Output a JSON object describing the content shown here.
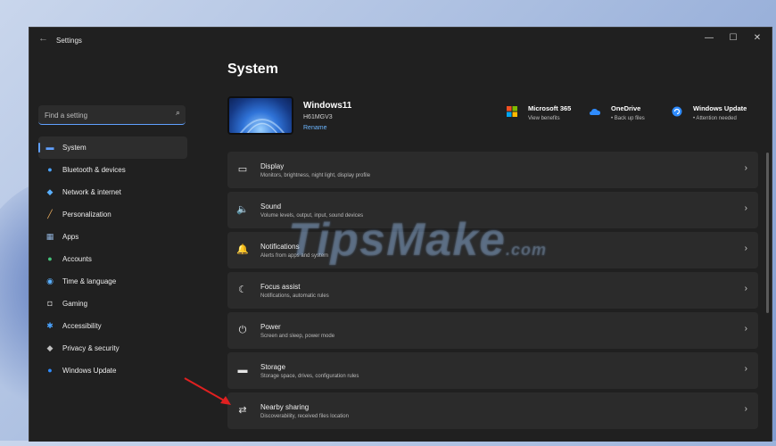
{
  "window": {
    "app_title": "Settings",
    "back_icon": "←",
    "controls": {
      "minimize": "—",
      "maximize": "☐",
      "close": "✕"
    }
  },
  "page": {
    "title": "System"
  },
  "search": {
    "placeholder": "Find a setting",
    "icon": "search-icon"
  },
  "sidebar": {
    "items": [
      {
        "label": "System",
        "icon": "monitor-icon",
        "active": true,
        "color": "#60a0ff"
      },
      {
        "label": "Bluetooth & devices",
        "icon": "bluetooth-icon",
        "color": "#4aa3ff"
      },
      {
        "label": "Network & internet",
        "icon": "wifi-icon",
        "color": "#5ab0ff"
      },
      {
        "label": "Personalization",
        "icon": "brush-icon",
        "color": "#f0b060"
      },
      {
        "label": "Apps",
        "icon": "apps-icon",
        "color": "#8fb0d8"
      },
      {
        "label": "Accounts",
        "icon": "person-icon",
        "color": "#45c27a"
      },
      {
        "label": "Time & language",
        "icon": "globe-icon",
        "color": "#5ab0ff"
      },
      {
        "label": "Gaming",
        "icon": "gamepad-icon",
        "color": "#b0b0b0"
      },
      {
        "label": "Accessibility",
        "icon": "accessibility-icon",
        "color": "#4aa3ff"
      },
      {
        "label": "Privacy & security",
        "icon": "shield-icon",
        "color": "#c0c0c0"
      },
      {
        "label": "Windows Update",
        "icon": "update-icon",
        "color": "#2f8cff"
      }
    ]
  },
  "device": {
    "name": "Windows11",
    "model": "H61MGV3",
    "rename_label": "Rename"
  },
  "quick_links": [
    {
      "title": "Microsoft 365",
      "subtitle": "View benefits",
      "icon": "microsoft-logo-icon"
    },
    {
      "title": "OneDrive",
      "subtitle": "• Back up files",
      "icon": "cloud-icon"
    },
    {
      "title": "Windows Update",
      "subtitle": "• Attention needed",
      "icon": "update-icon"
    }
  ],
  "settings": [
    {
      "title": "Display",
      "description": "Monitors, brightness, night light, display profile",
      "icon": "display-icon",
      "glyph": "▭"
    },
    {
      "title": "Sound",
      "description": "Volume levels, output, input, sound devices",
      "icon": "speaker-icon",
      "glyph": "🔈"
    },
    {
      "title": "Notifications",
      "description": "Alerts from apps and system",
      "icon": "bell-icon",
      "glyph": "🔔"
    },
    {
      "title": "Focus assist",
      "description": "Notifications, automatic rules",
      "icon": "moon-icon",
      "glyph": "☾"
    },
    {
      "title": "Power",
      "description": "Screen and sleep, power mode",
      "icon": "power-icon",
      "glyph": "⏻"
    },
    {
      "title": "Storage",
      "description": "Storage space, drives, configuration rules",
      "icon": "storage-icon",
      "glyph": "▬"
    },
    {
      "title": "Nearby sharing",
      "description": "Discoverability, received files location",
      "icon": "nearby-sharing-icon",
      "glyph": "⇄"
    }
  ],
  "chevron": "›",
  "watermark": {
    "main": "TipsMake",
    "suffix": ".com"
  },
  "colors": {
    "accent": "#60a0ff",
    "window_bg": "#202020",
    "card_bg": "#2b2b2b",
    "arrow": "#e02020"
  }
}
